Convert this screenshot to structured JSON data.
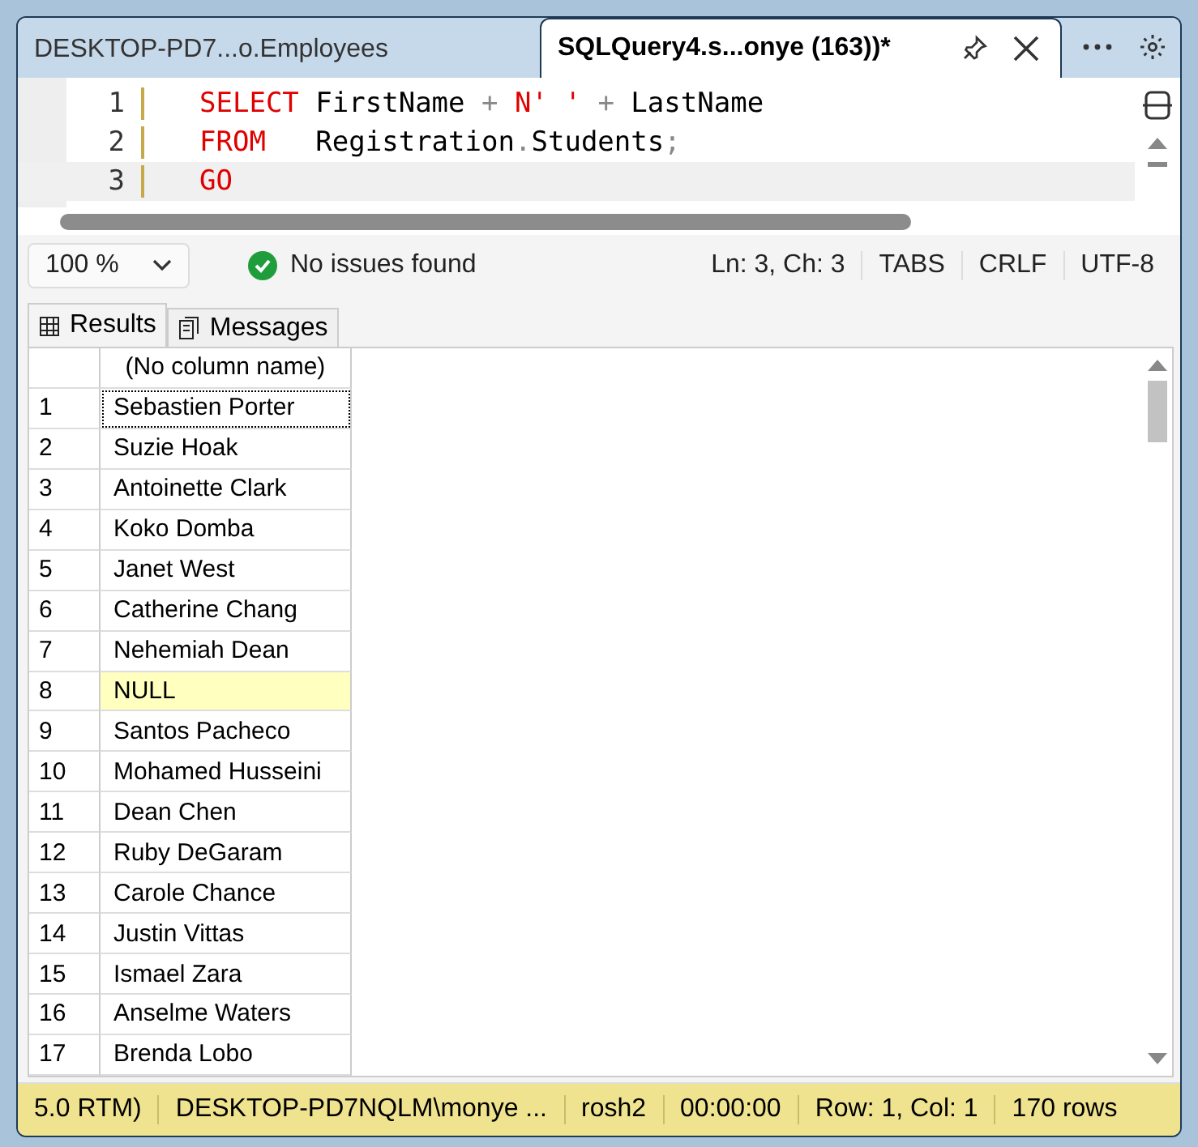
{
  "tabs": [
    {
      "label": "DESKTOP-PD7...o.Employees",
      "selected": false
    },
    {
      "label": "SQLQuery4.s...onye (163))*",
      "selected": true
    }
  ],
  "editor": {
    "lines": [
      {
        "number": "1",
        "current": false,
        "tokens": [
          {
            "text": "SELECT",
            "kind": "keyword"
          },
          {
            "text": " FirstName ",
            "kind": "plain"
          },
          {
            "text": "+",
            "kind": "operator"
          },
          {
            "text": " N' ' ",
            "kind": "string"
          },
          {
            "text": "+",
            "kind": "operator"
          },
          {
            "text": " LastName",
            "kind": "plain"
          }
        ]
      },
      {
        "number": "2",
        "current": false,
        "tokens": [
          {
            "text": "FROM",
            "kind": "keyword"
          },
          {
            "text": "   Registration",
            "kind": "plain"
          },
          {
            "text": ".",
            "kind": "operator"
          },
          {
            "text": "Students",
            "kind": "plain"
          },
          {
            "text": ";",
            "kind": "operator"
          }
        ]
      },
      {
        "number": "3",
        "current": true,
        "tokens": [
          {
            "text": "GO",
            "kind": "keyword"
          }
        ]
      }
    ]
  },
  "info_bar": {
    "zoom": "100 %",
    "issues": "No issues found",
    "position": "Ln: 3, Ch: 3",
    "indent": "TABS",
    "line_ending": "CRLF",
    "encoding": "UTF-8"
  },
  "result_tabs": [
    {
      "label": "Results",
      "selected": true
    },
    {
      "label": "Messages",
      "selected": false
    }
  ],
  "grid": {
    "column": "(No column name)",
    "rows": [
      {
        "number": "1",
        "value": "Sebastien Porter",
        "selected": true,
        "is_null": false
      },
      {
        "number": "2",
        "value": "Suzie Hoak",
        "selected": false,
        "is_null": false
      },
      {
        "number": "3",
        "value": "Antoinette Clark",
        "selected": false,
        "is_null": false
      },
      {
        "number": "4",
        "value": "Koko Domba",
        "selected": false,
        "is_null": false
      },
      {
        "number": "5",
        "value": "Janet West",
        "selected": false,
        "is_null": false
      },
      {
        "number": "6",
        "value": "Catherine Chang",
        "selected": false,
        "is_null": false
      },
      {
        "number": "7",
        "value": "Nehemiah Dean",
        "selected": false,
        "is_null": false
      },
      {
        "number": "8",
        "value": "NULL",
        "selected": false,
        "is_null": true
      },
      {
        "number": "9",
        "value": "Santos Pacheco",
        "selected": false,
        "is_null": false
      },
      {
        "number": "10",
        "value": "Mohamed Husseini",
        "selected": false,
        "is_null": false
      },
      {
        "number": "11",
        "value": "Dean Chen",
        "selected": false,
        "is_null": false
      },
      {
        "number": "12",
        "value": "Ruby DeGaram",
        "selected": false,
        "is_null": false
      },
      {
        "number": "13",
        "value": "Carole Chance",
        "selected": false,
        "is_null": false
      },
      {
        "number": "14",
        "value": "Justin Vittas",
        "selected": false,
        "is_null": false
      },
      {
        "number": "15",
        "value": "Ismael Zara",
        "selected": false,
        "is_null": false
      },
      {
        "number": "16",
        "value": "Anselme Waters",
        "selected": false,
        "is_null": false
      },
      {
        "number": "17",
        "value": "Brenda Lobo",
        "selected": false,
        "is_null": false
      }
    ]
  },
  "status_bar": [
    "5.0 RTM)",
    "DESKTOP-PD7NQLM\\monye ...",
    "rosh2",
    "00:00:00",
    "Row: 1, Col: 1",
    "170 rows"
  ]
}
